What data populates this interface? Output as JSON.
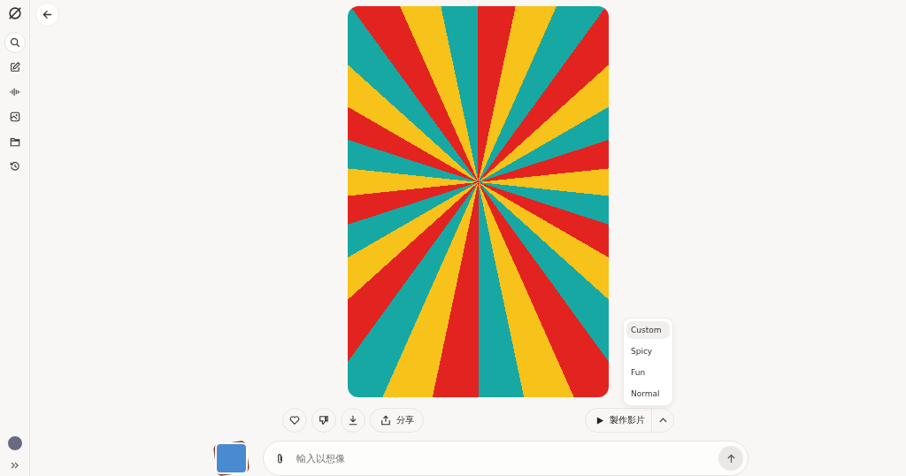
{
  "sidebar": {
    "items": [
      {
        "kind": "search",
        "selected": true
      },
      {
        "kind": "edit",
        "selected": false
      },
      {
        "kind": "voice",
        "selected": false
      },
      {
        "kind": "image",
        "selected": false
      },
      {
        "kind": "folder",
        "selected": false
      },
      {
        "kind": "history",
        "selected": false
      }
    ]
  },
  "actions": {
    "share_label": "分享",
    "video_label": "製作影片"
  },
  "mode_menu": {
    "items": [
      {
        "label": "Custom",
        "selected": true
      },
      {
        "label": "Spicy",
        "selected": false
      },
      {
        "label": "Fun",
        "selected": false
      },
      {
        "label": "Normal",
        "selected": false
      }
    ]
  },
  "composer": {
    "placeholder": "輸入以想像"
  }
}
